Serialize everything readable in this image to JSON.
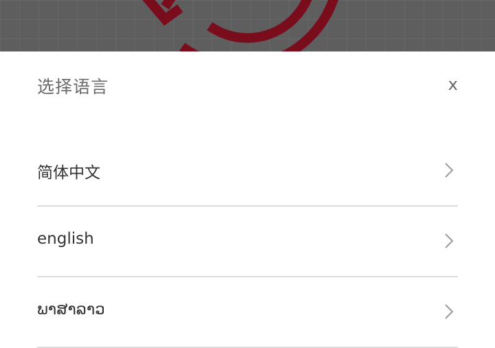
{
  "dialog": {
    "title": "选择语言",
    "close_label": "x"
  },
  "languages": [
    {
      "label": "简体中文",
      "icon": "chevron-right-icon"
    },
    {
      "label": "english",
      "icon": "chevron-right-icon"
    },
    {
      "label": "ພາສາລາວ",
      "icon": "chevron-right-icon"
    }
  ],
  "colors": {
    "logo_red": "#7a0d1c",
    "backdrop": "#5e5e5e",
    "divider": "#dcdcdc"
  }
}
